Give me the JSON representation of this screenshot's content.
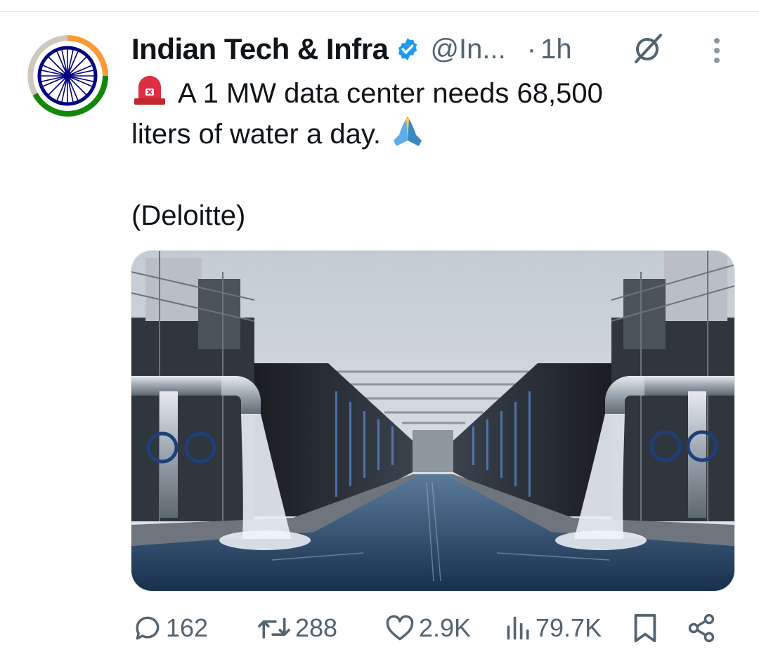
{
  "author": {
    "name": "Indian Tech & Infra",
    "handle": "@In...",
    "separator": "·",
    "time": "1h",
    "verified_color": "#1d9bf0"
  },
  "icons": [
    "avatar-emblem",
    "verified-badge-icon",
    "grok-icon",
    "more-icon",
    "siren-emoji",
    "folded-hands-emoji",
    "reply-icon",
    "repost-icon",
    "like-icon",
    "views-icon",
    "bookmark-icon",
    "share-icon"
  ],
  "tweet": {
    "line1": "A 1 MW data center needs 68,500",
    "line2": "liters of water a day.",
    "source": "(Deloitte)"
  },
  "stats": {
    "replies": "162",
    "reposts": "288",
    "likes": "2.9K",
    "views": "79.7K"
  },
  "colors": {
    "text": "#0f1419",
    "secondary": "#536471",
    "saffron": "#ff9933",
    "india_green": "#138808",
    "chakra_blue": "#000080"
  }
}
